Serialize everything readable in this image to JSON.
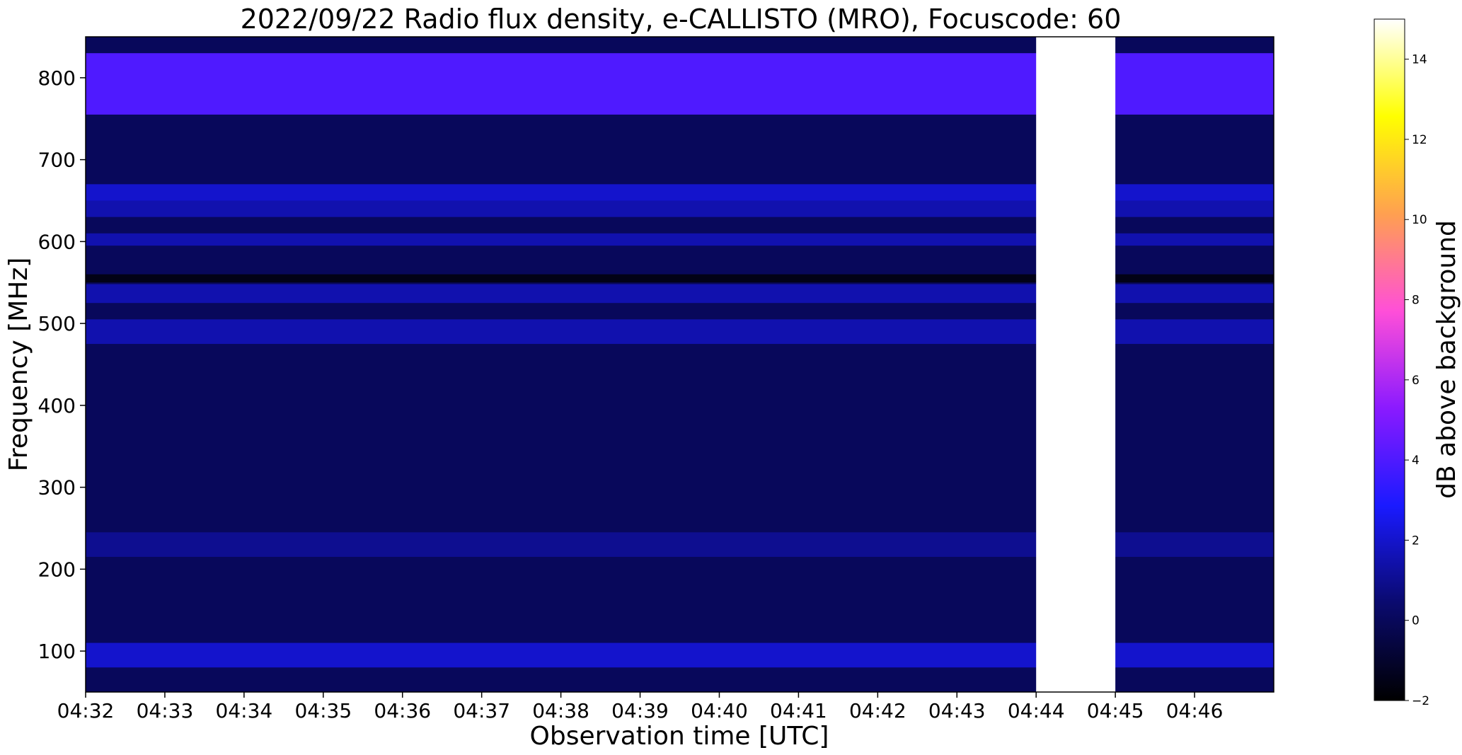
{
  "chart_data": {
    "type": "heatmap",
    "title": "2022/09/22  Radio flux density, e-CALLISTO (MRO), Focuscode: 60",
    "xlabel": "Observation time [UTC]",
    "ylabel": "Frequency [MHz]",
    "xlim": [
      "04:32",
      "04:47"
    ],
    "ylim": [
      50,
      850
    ],
    "x_ticks": [
      "04:32",
      "04:33",
      "04:34",
      "04:35",
      "04:36",
      "04:37",
      "04:38",
      "04:39",
      "04:40",
      "04:41",
      "04:42",
      "04:43",
      "04:44",
      "04:45",
      "04:46"
    ],
    "y_ticks": [
      100,
      200,
      300,
      400,
      500,
      600,
      700,
      800
    ],
    "colorbar": {
      "label": "dB above background",
      "range": [
        -2,
        15
      ],
      "ticks": [
        -2,
        0,
        2,
        4,
        6,
        8,
        10,
        12,
        14
      ],
      "colormap": [
        "#000000",
        "#0a0a6e",
        "#1a1aff",
        "#8a1aff",
        "#ff4fd8",
        "#ffa050",
        "#ffff00",
        "#ffffff"
      ]
    },
    "background_level_db": 0,
    "horizontal_bands": [
      {
        "freq_min": 755,
        "freq_max": 830,
        "db": 4
      },
      {
        "freq_min": 650,
        "freq_max": 670,
        "db": 2
      },
      {
        "freq_min": 630,
        "freq_max": 650,
        "db": 1.5
      },
      {
        "freq_min": 595,
        "freq_max": 610,
        "db": 1.5
      },
      {
        "freq_min": 550,
        "freq_max": 560,
        "db": -1.5
      },
      {
        "freq_min": 525,
        "freq_max": 548,
        "db": 1.5
      },
      {
        "freq_min": 475,
        "freq_max": 505,
        "db": 1.5
      },
      {
        "freq_min": 215,
        "freq_max": 245,
        "db": 1
      },
      {
        "freq_min": 80,
        "freq_max": 110,
        "db": 2
      }
    ],
    "bursts": [
      {
        "time_start": "04:44",
        "time_end": "04:45",
        "freq_min": 50,
        "freq_max": 850,
        "peak_db": 15
      }
    ]
  }
}
